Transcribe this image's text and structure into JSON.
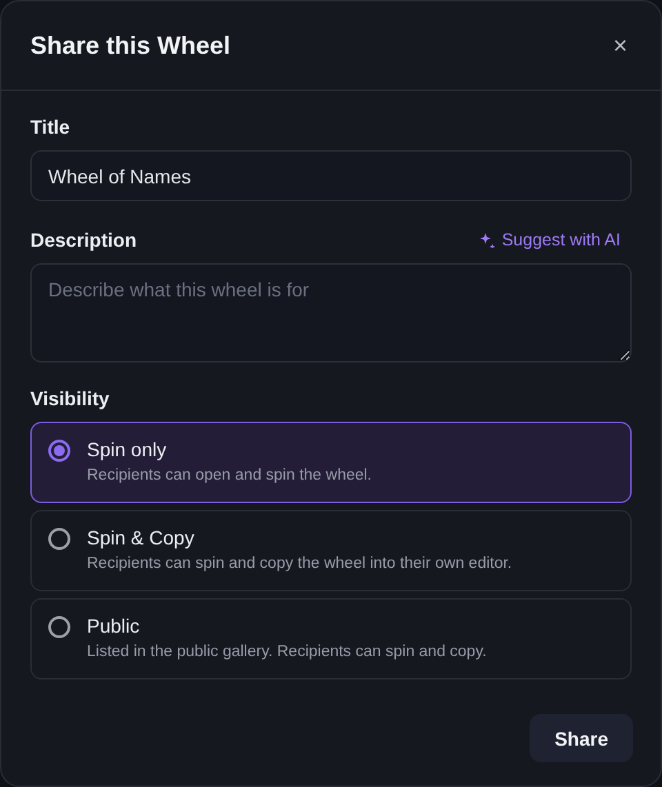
{
  "dialog": {
    "title": "Share this Wheel",
    "close": "×"
  },
  "title_field": {
    "label": "Title",
    "value": "Wheel of Names"
  },
  "description_field": {
    "label": "Description",
    "placeholder": "Describe what this wheel is for",
    "suggest": "Suggest with AI"
  },
  "visibility": {
    "label": "Visibility",
    "options": [
      {
        "label": "Spin only",
        "description": "Recipients can open and spin the wheel.",
        "selected": true
      },
      {
        "label": "Spin & Copy",
        "description": "Recipients can spin and copy the wheel into their own editor.",
        "selected": false
      },
      {
        "label": "Public",
        "description": "Listed in the public gallery. Recipients can spin and copy.",
        "selected": false
      }
    ]
  },
  "buttons": [
    "Share"
  ]
}
